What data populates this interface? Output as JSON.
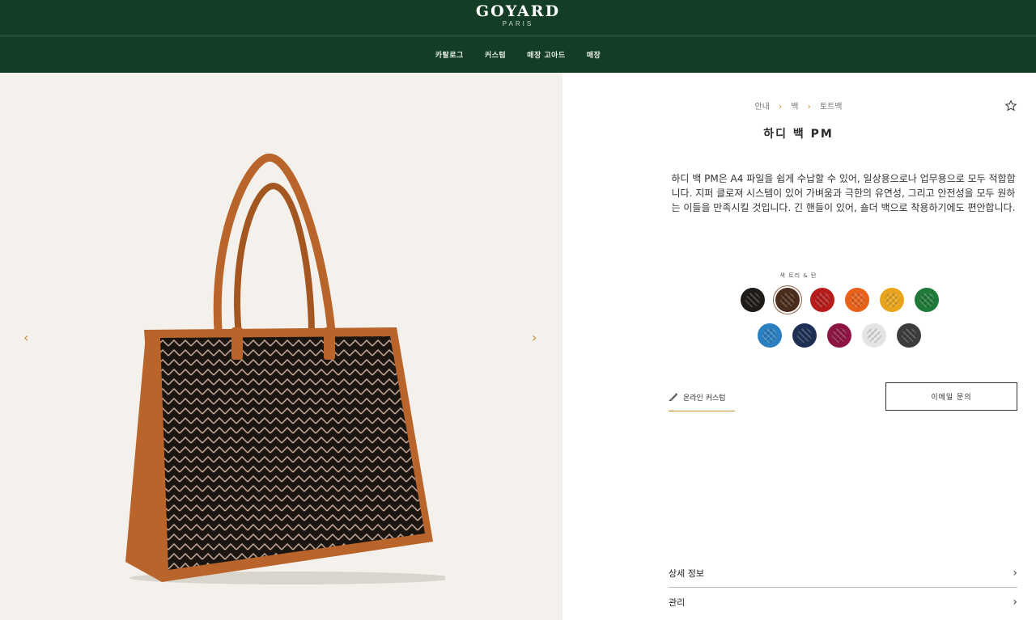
{
  "brand": {
    "name": "GOYARD",
    "sub": "PARIS"
  },
  "nav": {
    "items": [
      {
        "label": "카탈로그"
      },
      {
        "label": "커스텀"
      },
      {
        "label": "매장 고아드"
      },
      {
        "label": "매장"
      }
    ]
  },
  "gallery": {
    "prev": "‹",
    "next": "›"
  },
  "breadcrumb": {
    "items": [
      "안내",
      "백",
      "토트백"
    ],
    "separator": "›"
  },
  "product": {
    "title": "하디 백 PM",
    "description": "하디 백 PM은 A4 파일을 쉽게 수납할 수 있어, 일상용으로나 업무용으로 모두 적합합니다. 지퍼 클로져 시스템이 있어 가벼움과 극한의 유연성, 그리고 안전성을 모두 원하는 이들을 만족시킬 것입니다. 긴 핸들이 있어, 숄더 백으로 착용하기에도 편안합니다."
  },
  "colors": {
    "label": "색 트리 & 탄",
    "swatches_row1": [
      "#1e1b18",
      "#4a2c1c",
      "#b71c1c",
      "#e8611a",
      "#e8a41c",
      "#1f7a3a"
    ],
    "swatches_row2": [
      "#2a7fc1",
      "#1e2f55",
      "#8e1444",
      "#e4e4e4",
      "#3c3c3c"
    ],
    "selected_index": 1
  },
  "actions": {
    "custom_label": "온라인 커스텀",
    "email_label": "이메일 문의"
  },
  "accordion": {
    "details": "상세 정보",
    "care": "관리",
    "chevron": "›"
  }
}
